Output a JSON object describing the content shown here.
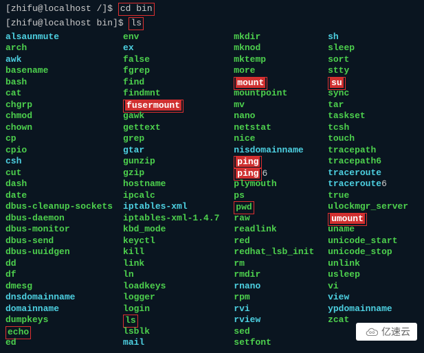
{
  "prompts": [
    {
      "text": "[zhifu@localhost /]$ ",
      "command": "cd bin"
    },
    {
      "text": "[zhifu@localhost bin]$ ",
      "command": "ls"
    }
  ],
  "columns": [
    [
      {
        "t": "alsaunmute",
        "c": "cyan"
      },
      {
        "t": "arch",
        "c": "green"
      },
      {
        "t": "awk",
        "c": "cyan"
      },
      {
        "t": "basename",
        "c": "green"
      },
      {
        "t": "bash",
        "c": "green"
      },
      {
        "t": "cat",
        "c": "green"
      },
      {
        "t": "chgrp",
        "c": "green"
      },
      {
        "t": "chmod",
        "c": "green"
      },
      {
        "t": "chown",
        "c": "green"
      },
      {
        "t": "cp",
        "c": "green"
      },
      {
        "t": "cpio",
        "c": "green"
      },
      {
        "t": "csh",
        "c": "cyan"
      },
      {
        "t": "cut",
        "c": "green"
      },
      {
        "t": "dash",
        "c": "green"
      },
      {
        "t": "date",
        "c": "green"
      },
      {
        "t": "dbus-cleanup-sockets",
        "c": "green"
      },
      {
        "t": "dbus-daemon",
        "c": "green"
      },
      {
        "t": "dbus-monitor",
        "c": "green"
      },
      {
        "t": "dbus-send",
        "c": "green"
      },
      {
        "t": "dbus-uuidgen",
        "c": "green"
      },
      {
        "t": "dd",
        "c": "green"
      },
      {
        "t": "df",
        "c": "green"
      },
      {
        "t": "dmesg",
        "c": "green"
      },
      {
        "t": "dnsdomainname",
        "c": "cyan"
      },
      {
        "t": "domainname",
        "c": "cyan"
      },
      {
        "t": "dumpkeys",
        "c": "green"
      },
      {
        "t": "echo",
        "c": "green",
        "boxed": true
      },
      {
        "t": "ed",
        "c": "green"
      }
    ],
    [
      {
        "t": "env",
        "c": "green"
      },
      {
        "t": "ex",
        "c": "cyan"
      },
      {
        "t": "false",
        "c": "green"
      },
      {
        "t": "fgrep",
        "c": "green"
      },
      {
        "t": "find",
        "c": "green"
      },
      {
        "t": "findmnt",
        "c": "green"
      },
      {
        "t": "fusermount",
        "c": "red-bg",
        "boxed": true
      },
      {
        "t": "gawk",
        "c": "green"
      },
      {
        "t": "gettext",
        "c": "green"
      },
      {
        "t": "grep",
        "c": "green"
      },
      {
        "t": "gtar",
        "c": "cyan"
      },
      {
        "t": "gunzip",
        "c": "green"
      },
      {
        "t": "gzip",
        "c": "green"
      },
      {
        "t": "hostname",
        "c": "green"
      },
      {
        "t": "ipcalc",
        "c": "green"
      },
      {
        "t": "iptables-xml",
        "c": "cyan"
      },
      {
        "t": "iptables-xml-1.4.7",
        "c": "green"
      },
      {
        "t": "kbd_mode",
        "c": "green"
      },
      {
        "t": "keyctl",
        "c": "green"
      },
      {
        "t": "kill",
        "c": "green"
      },
      {
        "t": "link",
        "c": "green"
      },
      {
        "t": "ln",
        "c": "green"
      },
      {
        "t": "loadkeys",
        "c": "green"
      },
      {
        "t": "logger",
        "c": "green"
      },
      {
        "t": "login",
        "c": "green"
      },
      {
        "t": "ls",
        "c": "green",
        "boxed": true
      },
      {
        "t": "lsblk",
        "c": "green"
      },
      {
        "t": "mail",
        "c": "cyan"
      }
    ],
    [
      {
        "t": "mkdir",
        "c": "green"
      },
      {
        "t": "mknod",
        "c": "green"
      },
      {
        "t": "mktemp",
        "c": "green"
      },
      {
        "t": "more",
        "c": "green"
      },
      {
        "t": "mount",
        "c": "red-bg",
        "boxed": true
      },
      {
        "t": "mountpoint",
        "c": "green"
      },
      {
        "t": "mv",
        "c": "green"
      },
      {
        "t": "nano",
        "c": "green"
      },
      {
        "t": "netstat",
        "c": "green"
      },
      {
        "t": "nice",
        "c": "green"
      },
      {
        "t": "nisdomainname",
        "c": "cyan"
      },
      {
        "t": "ping",
        "c": "red-bg",
        "boxed": true
      },
      {
        "t": "ping",
        "c": "red-bg",
        "boxed": true,
        "tail": "6"
      },
      {
        "t": "plymouth",
        "c": "green"
      },
      {
        "t": "ps",
        "c": "green"
      },
      {
        "t": "pwd",
        "c": "green",
        "boxed": true
      },
      {
        "t": "raw",
        "c": "green"
      },
      {
        "t": "readlink",
        "c": "green"
      },
      {
        "t": "red",
        "c": "green"
      },
      {
        "t": "redhat_lsb_init",
        "c": "green"
      },
      {
        "t": "rm",
        "c": "green"
      },
      {
        "t": "rmdir",
        "c": "green"
      },
      {
        "t": "rnano",
        "c": "cyan"
      },
      {
        "t": "rpm",
        "c": "green"
      },
      {
        "t": "rvi",
        "c": "cyan"
      },
      {
        "t": "rview",
        "c": "cyan"
      },
      {
        "t": "sed",
        "c": "green"
      },
      {
        "t": "setfont",
        "c": "green"
      }
    ],
    [
      {
        "t": "sh",
        "c": "cyan"
      },
      {
        "t": "sleep",
        "c": "green"
      },
      {
        "t": "sort",
        "c": "green"
      },
      {
        "t": "stty",
        "c": "green"
      },
      {
        "t": "su",
        "c": "red-bg",
        "boxed": true
      },
      {
        "t": "sync",
        "c": "green"
      },
      {
        "t": "tar",
        "c": "green"
      },
      {
        "t": "taskset",
        "c": "green"
      },
      {
        "t": "tcsh",
        "c": "green"
      },
      {
        "t": "touch",
        "c": "green"
      },
      {
        "t": "tracepath",
        "c": "green"
      },
      {
        "t": "tracepath6",
        "c": "green"
      },
      {
        "t": "traceroute",
        "c": "cyan"
      },
      {
        "t": "traceroute",
        "c": "cyan",
        "tail": "6"
      },
      {
        "t": "true",
        "c": "green"
      },
      {
        "t": "ulockmgr_server",
        "c": "green"
      },
      {
        "t": "umount",
        "c": "red-bg",
        "boxed": true
      },
      {
        "t": "uname",
        "c": "green"
      },
      {
        "t": "unicode_start",
        "c": "green"
      },
      {
        "t": "unicode_stop",
        "c": "green"
      },
      {
        "t": "unlink",
        "c": "green"
      },
      {
        "t": "usleep",
        "c": "green"
      },
      {
        "t": "vi",
        "c": "green"
      },
      {
        "t": "view",
        "c": "cyan"
      },
      {
        "t": "ypdomainname",
        "c": "cyan"
      },
      {
        "t": "zcat",
        "c": "green"
      }
    ]
  ],
  "watermark": "亿速云"
}
